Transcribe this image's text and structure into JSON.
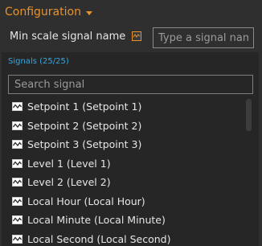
{
  "header": {
    "title": "Configuration"
  },
  "min_scale": {
    "label": "Min scale signal name",
    "input_placeholder": "Type a signal name",
    "input_value": ""
  },
  "signals": {
    "count_label": "Signals (25/25)",
    "search_placeholder": "Search signal",
    "items": [
      {
        "label": "Setpoint 1 (Setpoint 1)"
      },
      {
        "label": "Setpoint 2 (Setpoint 2)"
      },
      {
        "label": "Setpoint 3 (Setpoint 3)"
      },
      {
        "label": "Level 1 (Level 1)"
      },
      {
        "label": "Level 2 (Level 2)"
      },
      {
        "label": "Local Hour (Local Hour)"
      },
      {
        "label": "Local Minute (Local Minute)"
      },
      {
        "label": "Local Second (Local Second)"
      }
    ]
  },
  "icons": {
    "item_icon": "waveform-icon",
    "type_icon": "waveform-icon"
  },
  "colors": {
    "accent": "#e8922c",
    "count_text": "#3aa6dd",
    "background": "#2f2f2f",
    "panel": "#262626"
  }
}
